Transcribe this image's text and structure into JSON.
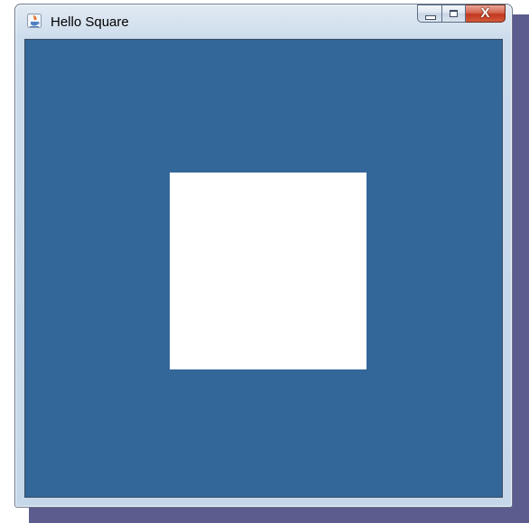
{
  "window": {
    "title": "Hello Square",
    "app_icon": "java-icon",
    "caption_buttons": {
      "minimize_icon": "minimize-icon",
      "maximize_icon": "maximize-icon",
      "close_icon": "close-icon",
      "close_glyph": "X"
    }
  },
  "canvas": {
    "background_color": "#336699",
    "shape": "square",
    "shape_color": "#ffffff"
  },
  "colors": {
    "shadow": "#5d5c8e",
    "close_button": "#c2371d"
  }
}
